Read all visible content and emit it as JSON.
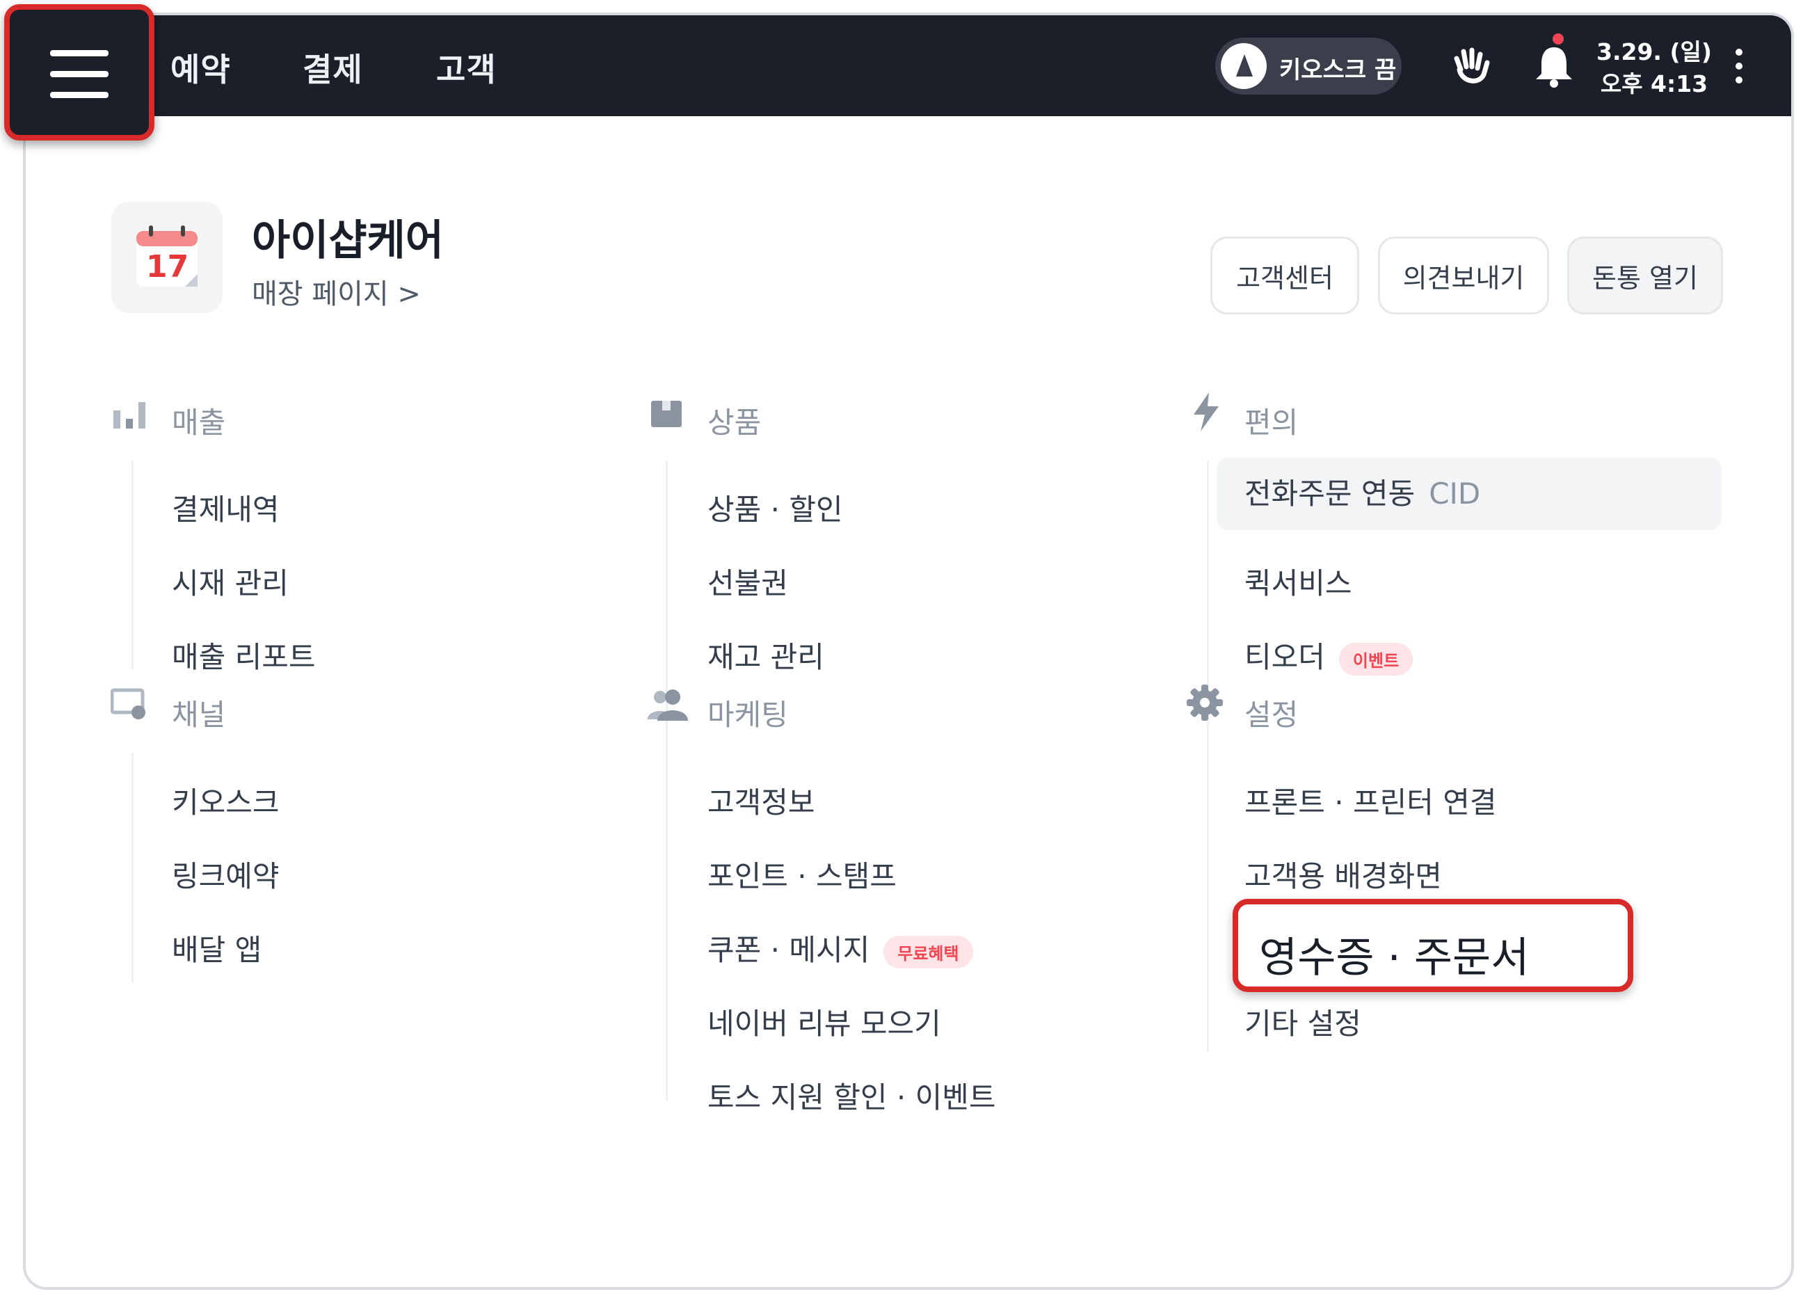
{
  "topbar": {
    "nav": [
      "예약",
      "결제",
      "고객"
    ],
    "kiosk_toggle": "키오스크 끔",
    "date": "3.29. (일)",
    "time": "오후 4:13"
  },
  "store": {
    "calendar_day": "17",
    "name": "아이샵케어",
    "page_link": "매장 페이지 >"
  },
  "header_buttons": [
    "고객센터",
    "의견보내기",
    "돈통 열기"
  ],
  "categories": {
    "sales": {
      "title": "매출",
      "items": [
        "결제내역",
        "시재 관리",
        "매출 리포트"
      ]
    },
    "products": {
      "title": "상품",
      "items": [
        "상품 · 할인",
        "선불권",
        "재고 관리"
      ]
    },
    "convenience": {
      "title": "편의",
      "items": [
        "전화주문 연동",
        "퀵서비스",
        "티오더"
      ],
      "cid_tag": "CID",
      "event_badge": "이벤트"
    },
    "channel": {
      "title": "채널",
      "items": [
        "키오스크",
        "링크예약",
        "배달 앱"
      ]
    },
    "marketing": {
      "title": "마케팅",
      "items": [
        "고객정보",
        "포인트 · 스탬프",
        "쿠폰 · 메시지",
        "네이버 리뷰 모으기",
        "토스 지원 할인 · 이벤트"
      ],
      "free_badge": "무료혜택"
    },
    "settings": {
      "title": "설정",
      "items": [
        "프론트 · 프린터 연결",
        "고객용 배경화면",
        "영수증 · 주문서",
        "기타 설정"
      ]
    }
  },
  "colors": {
    "topbar": "#1b1f29",
    "highlight": "#d92a2a",
    "badge_text": "#f04452",
    "badge_bg": "#fde4e6"
  }
}
